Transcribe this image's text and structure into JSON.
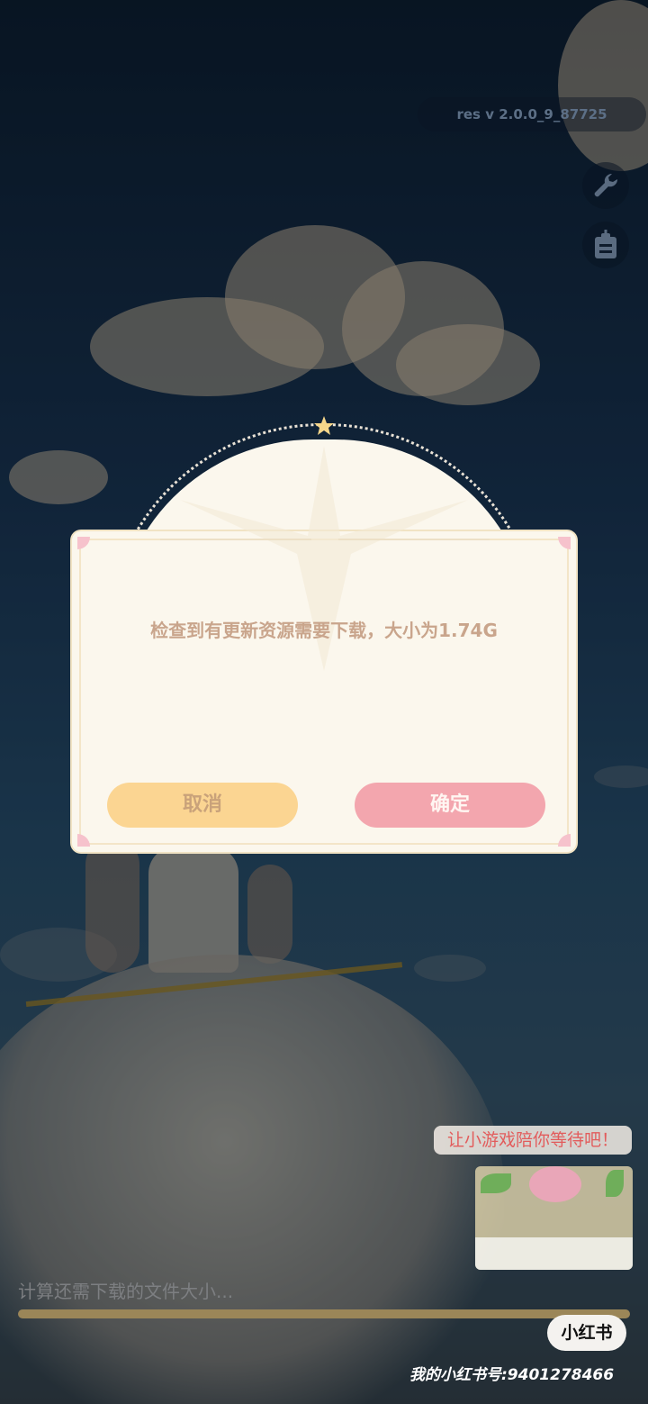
{
  "app": {
    "version": "res v 2.0.0_9_87725"
  },
  "toolbar": {
    "tools_icon": "wrench-icon",
    "notice_icon": "clipboard-icon"
  },
  "dialog": {
    "message": "检查到有更新资源需要下载，大小为1.74G",
    "cancel_label": "取消",
    "confirm_label": "确定"
  },
  "mini_game": {
    "prompt": "让小游戏陪你等待吧！"
  },
  "loading": {
    "status": "计算还需下载的文件大小...",
    "progress": 1.0
  },
  "overlay": {
    "brand": "小红书",
    "watermark": "我的小红书号:9401278466"
  },
  "colors": {
    "cancel_button": "#fbd592",
    "confirm_button": "#f3a6ae",
    "dialog_bg": "#fbf7ed",
    "progress_fill": "#9b8658"
  }
}
